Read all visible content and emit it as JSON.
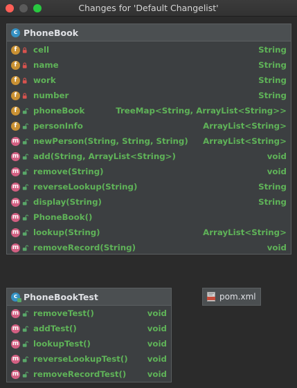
{
  "window": {
    "title": "Changes for 'Default Changelist'"
  },
  "phonebook": {
    "title": "PhoneBook",
    "members": [
      {
        "kind": "f",
        "vis": "private",
        "name": "cell",
        "type": "String"
      },
      {
        "kind": "f",
        "vis": "private",
        "name": "name",
        "type": "String"
      },
      {
        "kind": "f",
        "vis": "private",
        "name": "work",
        "type": "String"
      },
      {
        "kind": "f",
        "vis": "private",
        "name": "number",
        "type": "String"
      },
      {
        "kind": "f",
        "vis": "public",
        "name": "phoneBook",
        "type": "TreeMap<String, ArrayList<String>>"
      },
      {
        "kind": "f",
        "vis": "public",
        "name": "personInfo",
        "type": "ArrayList<String>"
      },
      {
        "kind": "m",
        "vis": "public",
        "name": "newPerson(String, String, String)",
        "type": "ArrayList<String>"
      },
      {
        "kind": "m",
        "vis": "public",
        "name": "add(String, ArrayList<String>)",
        "type": "void"
      },
      {
        "kind": "m",
        "vis": "public",
        "name": "remove(String)",
        "type": "void"
      },
      {
        "kind": "m",
        "vis": "public",
        "name": "reverseLookup(String)",
        "type": "String"
      },
      {
        "kind": "m",
        "vis": "public",
        "name": "display(String)",
        "type": "String"
      },
      {
        "kind": "m",
        "vis": "public",
        "name": "PhoneBook()",
        "type": ""
      },
      {
        "kind": "m",
        "vis": "public",
        "name": "lookup(String)",
        "type": "ArrayList<String>"
      },
      {
        "kind": "m",
        "vis": "public",
        "name": "removeRecord(String)",
        "type": "void"
      }
    ]
  },
  "phonebooktest": {
    "title": "PhoneBookTest",
    "members": [
      {
        "kind": "m",
        "vis": "public",
        "name": "removeTest()",
        "type": "void"
      },
      {
        "kind": "m",
        "vis": "public",
        "name": "addTest()",
        "type": "void"
      },
      {
        "kind": "m",
        "vis": "public",
        "name": "lookupTest()",
        "type": "void"
      },
      {
        "kind": "m",
        "vis": "public",
        "name": "reverseLookupTest()",
        "type": "void"
      },
      {
        "kind": "m",
        "vis": "public",
        "name": "removeRecordTest()",
        "type": "void"
      }
    ]
  },
  "pom": {
    "label": "pom.xml"
  },
  "colors": {
    "member_text": "#5fb358",
    "field_badge": "#c99133",
    "method_badge": "#d25f82",
    "class_badge": "#3592c4",
    "private_lock": "#d9534f",
    "public_lock": "#59a869"
  }
}
